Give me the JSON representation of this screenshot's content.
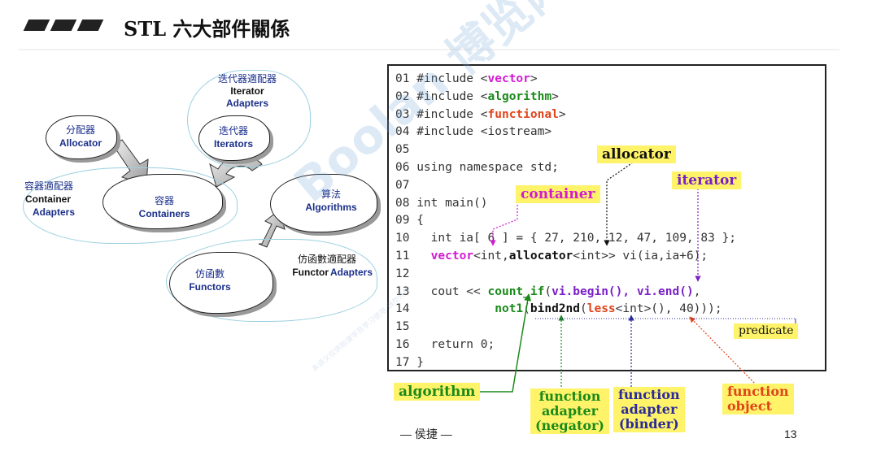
{
  "header": {
    "title": "STL 六大部件關係"
  },
  "diagram": {
    "iterator_adapters": {
      "zh": "迭代器適配器",
      "en1": "Iterator",
      "en2": "Adapters"
    },
    "allocator": {
      "zh": "分配器",
      "en": "Allocator"
    },
    "iterators": {
      "zh": "迭代器",
      "en": "Iterators"
    },
    "container_adapters": {
      "zh": "容器適配器",
      "en1": "Container",
      "en2": "Adapters"
    },
    "containers": {
      "zh": "容器",
      "en": "Containers"
    },
    "algorithms": {
      "zh": "算法",
      "en": "Algorithms"
    },
    "functor_adapters": {
      "zh": "仿函數適配器",
      "en1": "Functor",
      "en2": "Adapters"
    },
    "functors": {
      "zh": "仿函數",
      "en": "Functors"
    }
  },
  "code": {
    "lines": [
      {
        "no": "01",
        "parts": [
          [
            "",
            "#include <"
          ],
          [
            "mag",
            "vector"
          ],
          [
            "",
            ">"
          ]
        ]
      },
      {
        "no": "02",
        "parts": [
          [
            "",
            "#include <"
          ],
          [
            "grn",
            "algorithm"
          ],
          [
            "",
            ">"
          ]
        ]
      },
      {
        "no": "03",
        "parts": [
          [
            "",
            "#include <"
          ],
          [
            "org",
            "functional"
          ],
          [
            "",
            ">"
          ]
        ]
      },
      {
        "no": "04",
        "parts": [
          [
            "",
            "#include <iostream>"
          ]
        ]
      },
      {
        "no": "05",
        "parts": [
          [
            "",
            ""
          ]
        ]
      },
      {
        "no": "06",
        "parts": [
          [
            "",
            "using namespace std;"
          ]
        ]
      },
      {
        "no": "07",
        "parts": [
          [
            "",
            ""
          ]
        ]
      },
      {
        "no": "08",
        "parts": [
          [
            "",
            "int main()"
          ]
        ]
      },
      {
        "no": "09",
        "parts": [
          [
            "",
            "{"
          ]
        ]
      },
      {
        "no": "10",
        "parts": [
          [
            "",
            "  int ia[ 6 ] = { 27, 210, 12, 47, 109, 83 };"
          ]
        ]
      },
      {
        "no": "11",
        "parts": [
          [
            "",
            "  "
          ],
          [
            "mag",
            "vector"
          ],
          [
            "",
            "<int,"
          ],
          [
            "blkb",
            "allocator"
          ],
          [
            "",
            "<int>> vi(ia,ia+6);"
          ]
        ]
      },
      {
        "no": "12",
        "parts": [
          [
            "",
            ""
          ]
        ]
      },
      {
        "no": "13",
        "parts": [
          [
            "",
            "  cout << "
          ],
          [
            "grn",
            "count_if"
          ],
          [
            "",
            "("
          ],
          [
            "pur",
            "vi.begin(), vi.end()"
          ],
          [
            "",
            ","
          ]
        ]
      },
      {
        "no": "14",
        "parts": [
          [
            "",
            "           "
          ],
          [
            "grn",
            "not1"
          ],
          [
            "",
            "("
          ],
          [
            "blkb",
            "bind2nd"
          ],
          [
            "",
            "("
          ],
          [
            "org",
            "less"
          ],
          [
            "",
            "<int>(), 40)));"
          ]
        ]
      },
      {
        "no": "15",
        "parts": [
          [
            "",
            ""
          ]
        ]
      },
      {
        "no": "16",
        "parts": [
          [
            "",
            "  return 0;"
          ]
        ]
      },
      {
        "no": "17",
        "parts": [
          [
            "",
            "}"
          ]
        ]
      }
    ]
  },
  "annotations": {
    "allocator": "allocator",
    "container": "container",
    "iterator": "iterator",
    "predicate": "predicate",
    "algorithm": "algorithm",
    "function_adapter_negator": [
      "function",
      "adapter",
      "(negator)"
    ],
    "function_adapter_binder": [
      "function",
      "adapter",
      "(binder)"
    ],
    "function_object": [
      "function",
      "object"
    ]
  },
  "colors": {
    "allocator": "#111111",
    "container": "#d21ad2",
    "iterator": "#7a1fc8",
    "algorithm": "#1a8a1a",
    "negator": "#1a8a1a",
    "binder": "#2a2a9a",
    "function_object": "#e0441a",
    "highlight": "#fff36a"
  },
  "footer": {
    "author": "— 侯捷 —",
    "page": "13"
  },
  "watermark": {
    "main": "Boolan 博览网",
    "small": "本讲义仅供购课学员学习使用 请勿外传"
  }
}
